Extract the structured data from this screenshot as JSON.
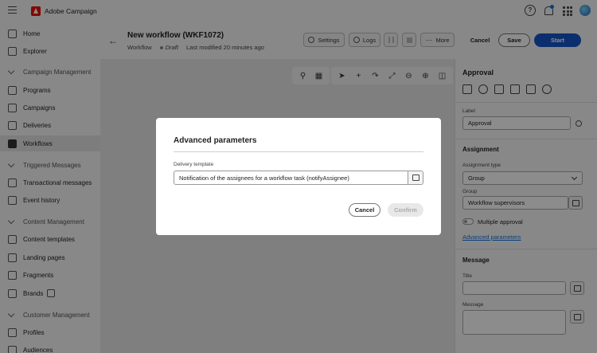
{
  "app": {
    "title": "Adobe Campaign"
  },
  "sidebar": {
    "items": [
      {
        "label": "Home",
        "icon": "home-icon"
      },
      {
        "label": "Explorer",
        "icon": "explorer-icon"
      }
    ],
    "sections": [
      {
        "title": "Campaign Management",
        "items": [
          {
            "label": "Programs",
            "icon": "folder-icon"
          },
          {
            "label": "Campaigns",
            "icon": "campaign-icon"
          },
          {
            "label": "Deliveries",
            "icon": "send-icon"
          },
          {
            "label": "Workflows",
            "icon": "workflow-icon",
            "active": true
          }
        ]
      },
      {
        "title": "Triggered Messages",
        "items": [
          {
            "label": "Transactional messages",
            "icon": "transactional-icon"
          },
          {
            "label": "Event history",
            "icon": "event-icon"
          }
        ]
      },
      {
        "title": "Content Management",
        "items": [
          {
            "label": "Content templates",
            "icon": "template-icon"
          },
          {
            "label": "Landing pages",
            "icon": "landing-icon"
          },
          {
            "label": "Fragments",
            "icon": "fragment-icon"
          },
          {
            "label": "Brands",
            "icon": "brand-icon"
          }
        ]
      },
      {
        "title": "Customer Management",
        "items": [
          {
            "label": "Profiles",
            "icon": "profile-icon"
          },
          {
            "label": "Audiences",
            "icon": "audience-icon"
          }
        ]
      }
    ]
  },
  "header": {
    "title": "New workflow (WKF1072)",
    "type": "Workflow",
    "status": "Draft",
    "modified": "Last modified 20 minutes ago",
    "settings_label": "Settings",
    "logs_label": "Logs",
    "more_label": "More",
    "cancel_label": "Cancel",
    "save_label": "Save",
    "start_label": "Start"
  },
  "panel": {
    "title": "Approval",
    "label_caption": "Label",
    "label_value": "Approval",
    "assignment_title": "Assignment",
    "assignment_type_caption": "Assignment type",
    "assignment_type_value": "Group",
    "group_caption": "Group",
    "group_value": "Workflow supervisors",
    "multiple_approval": "Multiple approval",
    "advanced_link": "Advanced parameters",
    "message_title": "Message",
    "title_caption": "Title",
    "message_caption": "Message"
  },
  "modal": {
    "title": "Advanced parameters",
    "field_label": "Delivery template",
    "field_value": "Notification of the assignees for a workflow task (notifyAssignee)",
    "cancel_label": "Cancel",
    "confirm_label": "Confirm"
  },
  "colors": {
    "accent": "#1473e6",
    "brand": "#eb1000"
  }
}
